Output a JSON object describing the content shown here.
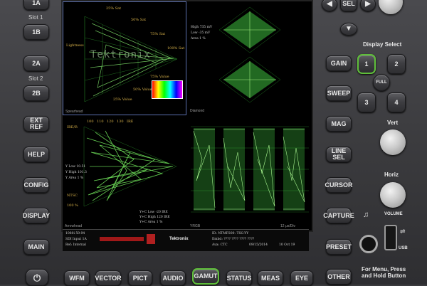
{
  "left_buttons": {
    "input_1a": "1A",
    "slot1_label": "Slot 1",
    "input_1b": "1B",
    "input_2a": "2A",
    "slot2_label": "Slot 2",
    "input_2b": "2B",
    "ext_ref": "EXT REF",
    "help": "HELP",
    "config": "CONFIG",
    "display": "DISPLAY",
    "main": "MAIN"
  },
  "bottom_buttons": [
    "WFM",
    "VECTOR",
    "PICT",
    "AUDIO",
    "GAMUT",
    "STATUS",
    "MEAS",
    "EYE"
  ],
  "right_buttons": {
    "sel": "SEL",
    "gain": "GAIN",
    "sweep": "SWEEP",
    "mag": "MAG",
    "line_sel": "LINE SEL",
    "cursor": "CURSOR",
    "capture": "CAPTURE",
    "preset": "PRESET",
    "other": "OTHER"
  },
  "display_select": {
    "title": "Display Select",
    "tiles": [
      "1",
      "2",
      "3",
      "4"
    ],
    "full": "FULL"
  },
  "knobs": {
    "vert": "Vert",
    "horiz": "Horiz"
  },
  "volume_label": "VOLUME",
  "usb_label": "USB",
  "menu_note": "For Menu, Press\nand Hold Button",
  "screen": {
    "quad1": {
      "name": "Spearhead",
      "watermark": "Tektronix",
      "labels": [
        "25% Sat",
        "50% Sat",
        "75% Sat",
        "100% Sat",
        "Lightness",
        "25% Value",
        "50% Value",
        "75% Value"
      ]
    },
    "quad2": {
      "name": "Diamond",
      "readout": [
        "High 735 mV",
        "Low -35 mV",
        "Area 1 %"
      ]
    },
    "quad3": {
      "name": "Arrowhead",
      "top_ticks": [
        "100",
        "110",
        "120",
        "130",
        "IRE"
      ],
      "left_labels": [
        "IRE/R",
        "NTSC",
        "100 %"
      ],
      "readout_left": [
        "Y Low 10.51",
        "Y High 101.3",
        "Y Area 1 %"
      ],
      "readout_right": [
        "Y+C Low -20 IRE",
        "Y+C High 120 IRE",
        "Y+C Area 1 %"
      ]
    },
    "quad4": {
      "name": "YRGB",
      "time": "12 μs/Div"
    }
  },
  "status_bar": {
    "left_lines": [
      "1080i 59.94",
      "SDI Input 1A",
      "Ref: Internal"
    ],
    "center_lines": [
      "ID: NTMP200: TSG-YY",
      "Embd: ???? ???? ???? ????",
      "Aux: CTC"
    ],
    "date": "09/15/2014",
    "time": "10 Oct 19",
    "logo": "Tektronix"
  }
}
